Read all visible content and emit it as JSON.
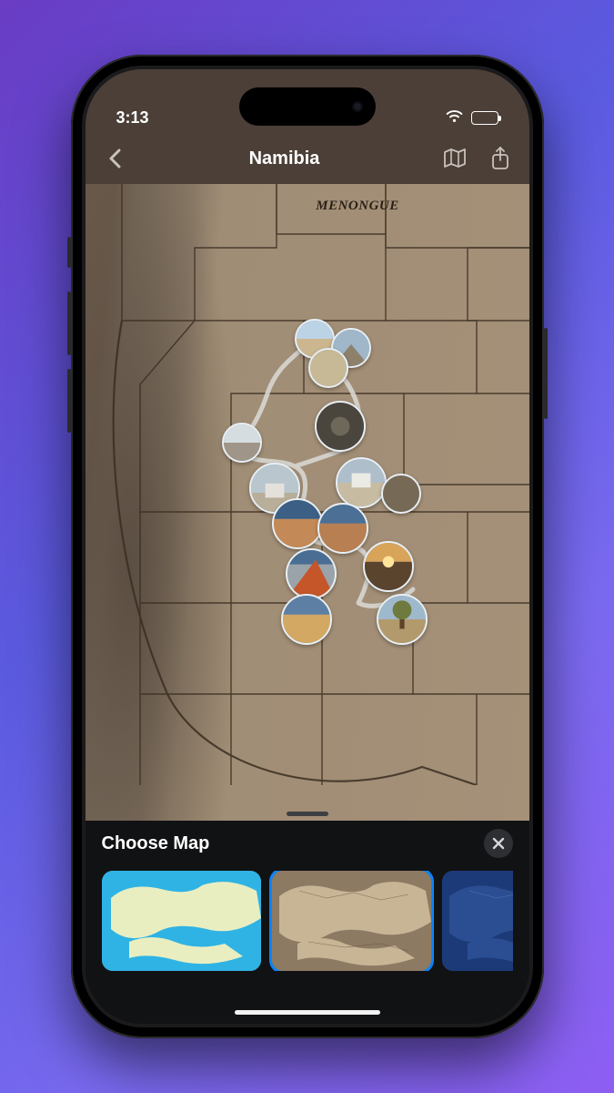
{
  "status": {
    "time": "3:13"
  },
  "nav": {
    "title": "Namibia"
  },
  "map": {
    "cityLabel": "MENONGUE"
  },
  "sheet": {
    "title": "Choose Map",
    "options": [
      "light",
      "sepia",
      "dark"
    ],
    "selectedIndex": 1
  },
  "colors": {
    "accent": "#0a84ff",
    "navBg": "#4b3f37"
  }
}
